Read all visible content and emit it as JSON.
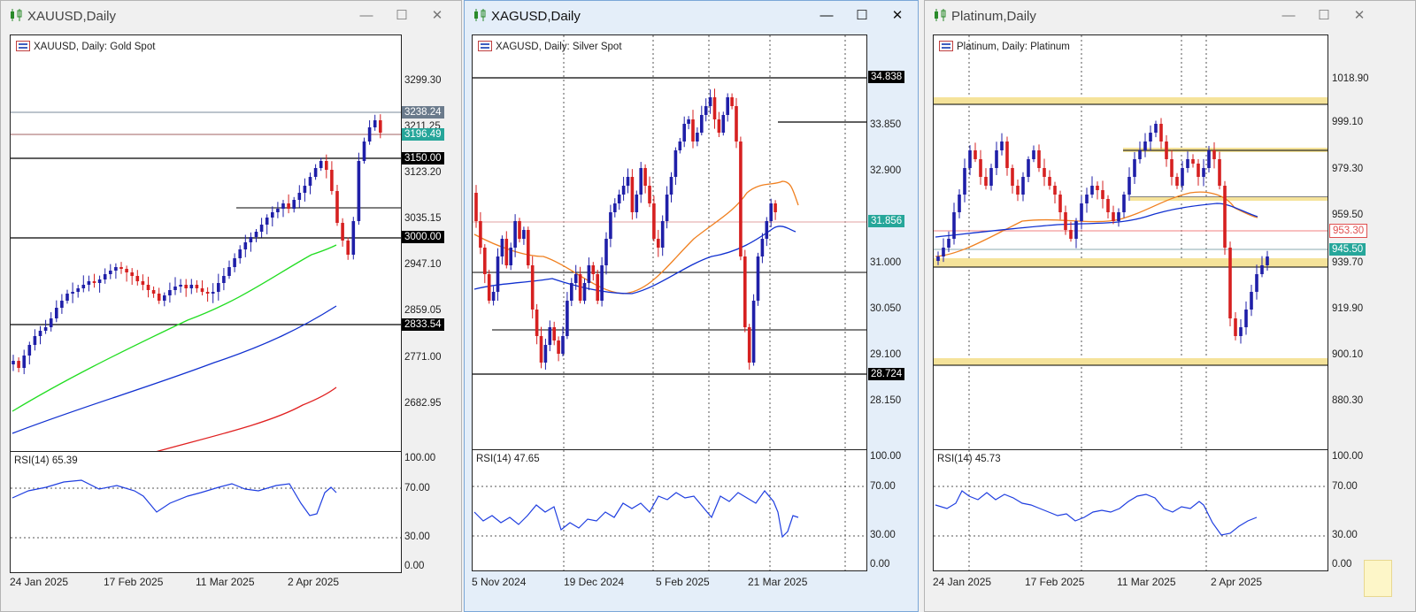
{
  "windows": [
    {
      "title": "XAUUSD,Daily",
      "active": false,
      "chart_title": "XAUUSD, Daily:  Gold Spot",
      "price_labels": [
        "3299.30",
        "3211.25",
        "3123.20",
        "3035.15",
        "2947.10",
        "2859.05",
        "2771.00",
        "2682.95"
      ],
      "price_tags": [
        {
          "text": "3238.24",
          "bg": "#6b7b8c",
          "fg": "#ffffff"
        },
        {
          "text": "3196.49",
          "bg": "#26a69a",
          "fg": "#ffffff"
        },
        {
          "text": "3150.00",
          "bg": "#000000",
          "fg": "#ffffff"
        },
        {
          "text": "3000.00",
          "bg": "#000000",
          "fg": "#ffffff"
        },
        {
          "text": "2833.54",
          "bg": "#000000",
          "fg": "#ffffff"
        }
      ],
      "rsi_title": "RSI(14) 65.39",
      "rsi_labels": [
        "100.00",
        "70.00",
        "30.00",
        "0.00"
      ],
      "date_labels": [
        "24 Jan 2025",
        "17 Feb 2025",
        "11 Mar 2025",
        "2 Apr 2025"
      ]
    },
    {
      "title": "XAGUSD,Daily",
      "active": true,
      "chart_title": "XAGUSD, Daily:  Silver Spot",
      "price_labels": [
        "33.850",
        "32.900",
        "31.000",
        "30.050",
        "29.100",
        "28.150"
      ],
      "price_tags": [
        {
          "text": "34.838",
          "bg": "#000000",
          "fg": "#ffffff"
        },
        {
          "text": "31.856",
          "bg": "#26a69a",
          "fg": "#ffffff"
        },
        {
          "text": "28.724",
          "bg": "#000000",
          "fg": "#ffffff"
        }
      ],
      "rsi_title": "RSI(14) 47.65",
      "rsi_labels": [
        "100.00",
        "70.00",
        "30.00",
        "0.00"
      ],
      "date_labels": [
        "5 Nov 2024",
        "19 Dec 2024",
        "5 Feb 2025",
        "21 Mar 2025"
      ]
    },
    {
      "title": "Platinum,Daily",
      "active": false,
      "chart_title": "Platinum, Daily:  Platinum",
      "price_labels": [
        "1018.90",
        "999.10",
        "979.30",
        "959.50",
        "939.70",
        "919.90",
        "900.10",
        "880.30"
      ],
      "price_tags": [
        {
          "text": "953.30",
          "bg": "#ffffff",
          "fg": "#e05050"
        },
        {
          "text": "945.50",
          "bg": "#26a69a",
          "fg": "#ffffff"
        }
      ],
      "rsi_title": "RSI(14) 45.73",
      "rsi_labels": [
        "100.00",
        "70.00",
        "30.00",
        "0.00"
      ],
      "date_labels": [
        "24 Jan 2025",
        "17 Feb 2025",
        "11 Mar 2025",
        "2 Apr 2025"
      ]
    }
  ],
  "buttons": {
    "minimize": "—",
    "maximize": "☐",
    "close": "✕"
  },
  "colors": {
    "bull": "#1f1fa8",
    "bear": "#d62020",
    "ma_fast": "#f08020",
    "ma_mid": "#1030d0",
    "ma_green": "#22dd22",
    "ma_red": "#e02020",
    "rsi": "#1f3ee0",
    "zone": "#f5e39a"
  }
}
